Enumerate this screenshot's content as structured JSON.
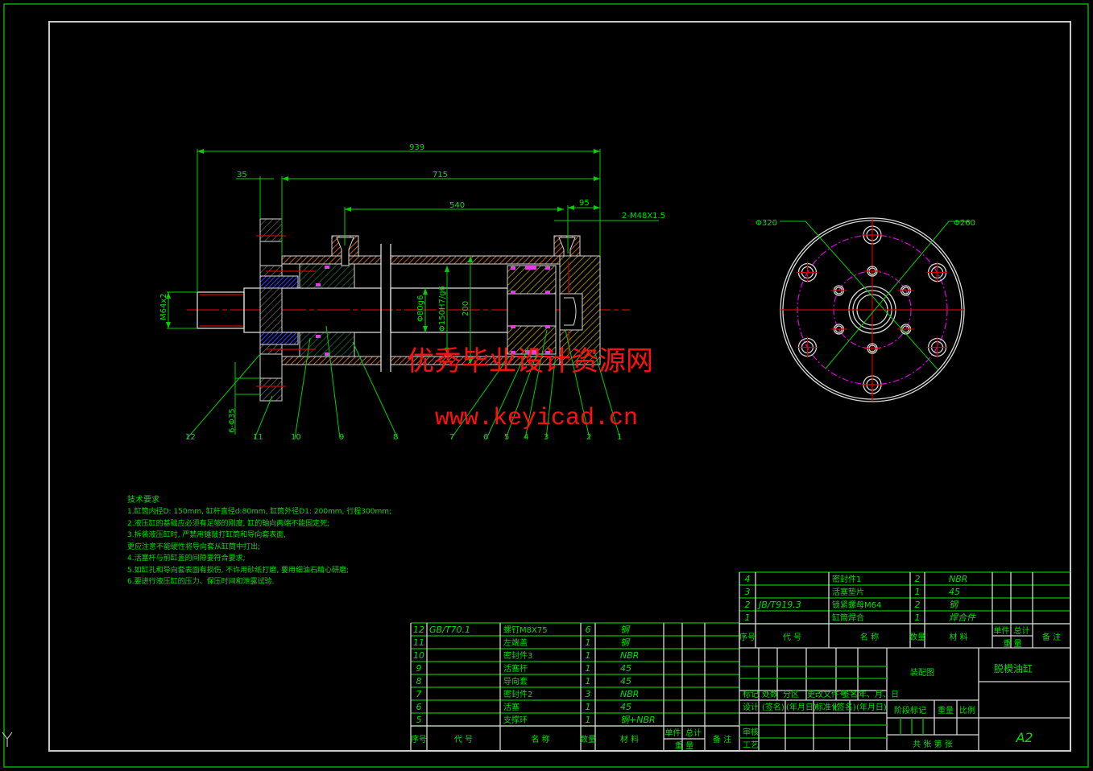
{
  "drawing": {
    "title": "脱模油缸",
    "drawing_type": "装配图",
    "sheet_size": "A2",
    "sheet_text": "共  张  第  张",
    "colors": {
      "background": "#000000",
      "lines": "#d8d8d8",
      "dimensions": "#00e000",
      "centerlines": "#d00000",
      "pitch_circles": "#e000e0",
      "watermark": "#ff0000"
    }
  },
  "dimensions": {
    "overall_length": "939",
    "barrel_length": "715",
    "flange_thickness": "35",
    "port_spacing": "540",
    "end_port_offset": "95",
    "port_thread": "2-M48X1.5",
    "rod_thread": "M64x2",
    "rod_diameter": "Φ80g6",
    "bore_fit": "Φ150H7/g6",
    "barrel_od": "200",
    "flange_holes": "6-Φ35",
    "flange_od": "Φ320",
    "bolt_circle": "Φ260"
  },
  "balloons": [
    "12",
    "11",
    "10",
    "9",
    "8",
    "7",
    "6",
    "5",
    "4",
    "3",
    "2",
    "1"
  ],
  "tech_requirements": {
    "heading": "技术要求",
    "items": [
      "1.缸筒内径D: 150mm, 缸杆直径d:80mm, 缸筒外径D1: 200mm, 行程300mm;",
      "2.液压缸的基础应必须有足够的刚度, 缸的轴向两端不能固定死;",
      "3.拆装液压缸时, 严禁用锤敲打缸筒和导向套表面,",
      "更应注意不能硬性将导向套从缸筒中打出;",
      "4.活塞杆与前缸盖的间隙要符合要求;",
      "5.如缸孔和导向套表面有损伤, 不许用砂纸打磨, 要用细油石精心研磨;",
      "6.要进行液压缸的压力、保压时间和泄露试验."
    ]
  },
  "bom_upper": {
    "rows": [
      {
        "no": "4",
        "code": "",
        "name": "密封件1",
        "qty": "2",
        "material": "NBR"
      },
      {
        "no": "3",
        "code": "",
        "name": "活塞垫片",
        "qty": "1",
        "material": "45"
      },
      {
        "no": "2",
        "code": "JB/T919.3",
        "name": "锁紧螺母M64",
        "qty": "2",
        "material": "钢"
      },
      {
        "no": "1",
        "code": "",
        "name": "缸筒焊合",
        "qty": "1",
        "material": "焊合件"
      }
    ]
  },
  "bom_lower": {
    "rows": [
      {
        "no": "12",
        "code": "GB/T70.1",
        "name": "螺钉M8X75",
        "qty": "6",
        "material": "钢"
      },
      {
        "no": "11",
        "code": "",
        "name": "左端盖",
        "qty": "1",
        "material": "钢"
      },
      {
        "no": "10",
        "code": "",
        "name": "密封件3",
        "qty": "1",
        "material": "NBR"
      },
      {
        "no": "9",
        "code": "",
        "name": "活塞杆",
        "qty": "1",
        "material": "45"
      },
      {
        "no": "8",
        "code": "",
        "name": "导向套",
        "qty": "1",
        "material": "45"
      },
      {
        "no": "7",
        "code": "",
        "name": "密封件2",
        "qty": "3",
        "material": "NBR"
      },
      {
        "no": "6",
        "code": "",
        "name": "活塞",
        "qty": "1",
        "material": "45"
      },
      {
        "no": "5",
        "code": "",
        "name": "支撑环",
        "qty": "1",
        "material": "钢+NBR"
      }
    ]
  },
  "bom_header": {
    "no": "序号",
    "code": "代  号",
    "name": "名  称",
    "qty": "数量",
    "material": "材  料",
    "unit": "单件",
    "total": "总计",
    "weight": "重  量",
    "remark": "备  注"
  },
  "title_block": {
    "mark": "标记",
    "count": "处数",
    "zone": "分区",
    "change_doc": "更改文件号",
    "sign": "签名",
    "date": "年、月、日",
    "design": "设计",
    "sign_paren": "(签名)",
    "date_paren": "(年月日)",
    "standard": "标准化",
    "review": "审核",
    "process": "工艺",
    "stage_mark": "阶段标记",
    "weight": "重量",
    "scale": "比例"
  },
  "watermark": {
    "cn": "优秀毕业设计资源网",
    "url": "www.keyicad.cn"
  },
  "ucs_icon_label": "Y"
}
